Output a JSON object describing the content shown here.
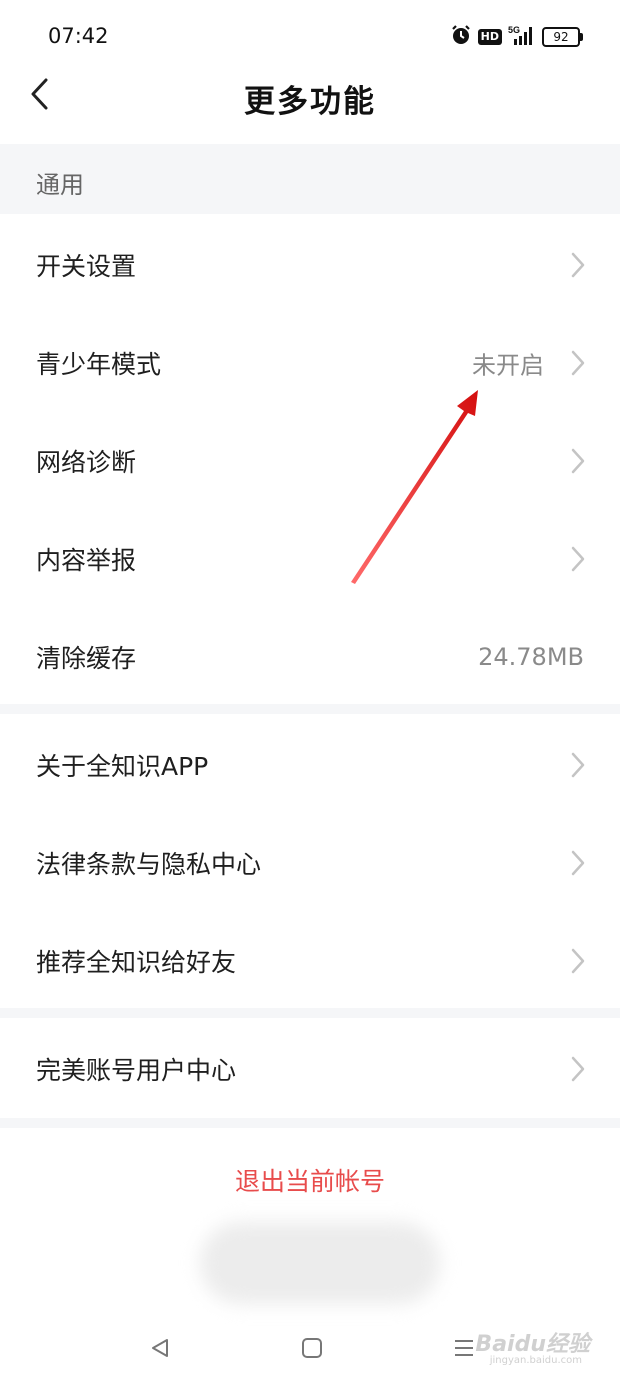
{
  "status_bar": {
    "time": "07:42",
    "network": "5G",
    "hd": "HD",
    "battery": "92"
  },
  "header": {
    "title": "更多功能"
  },
  "section": {
    "title": "通用"
  },
  "group1": [
    {
      "label": "开关设置",
      "value": ""
    },
    {
      "label": "青少年模式",
      "value": "未开启"
    },
    {
      "label": "网络诊断",
      "value": ""
    },
    {
      "label": "内容举报",
      "value": ""
    },
    {
      "label": "清除缓存",
      "value": "24.78MB"
    }
  ],
  "group2": [
    {
      "label": "关于全知识APP"
    },
    {
      "label": "法律条款与隐私中心"
    },
    {
      "label": "推荐全知识给好友"
    }
  ],
  "group3": [
    {
      "label": "完美账号用户中心"
    }
  ],
  "logout": {
    "label": "退出当前帐号"
  },
  "watermark": {
    "brand": "Baidu经验",
    "url": "jingyan.baidu.com"
  },
  "colors": {
    "accent_red": "#e84c4c",
    "section_bg": "#f5f6f8",
    "annotation": "#e01515"
  }
}
